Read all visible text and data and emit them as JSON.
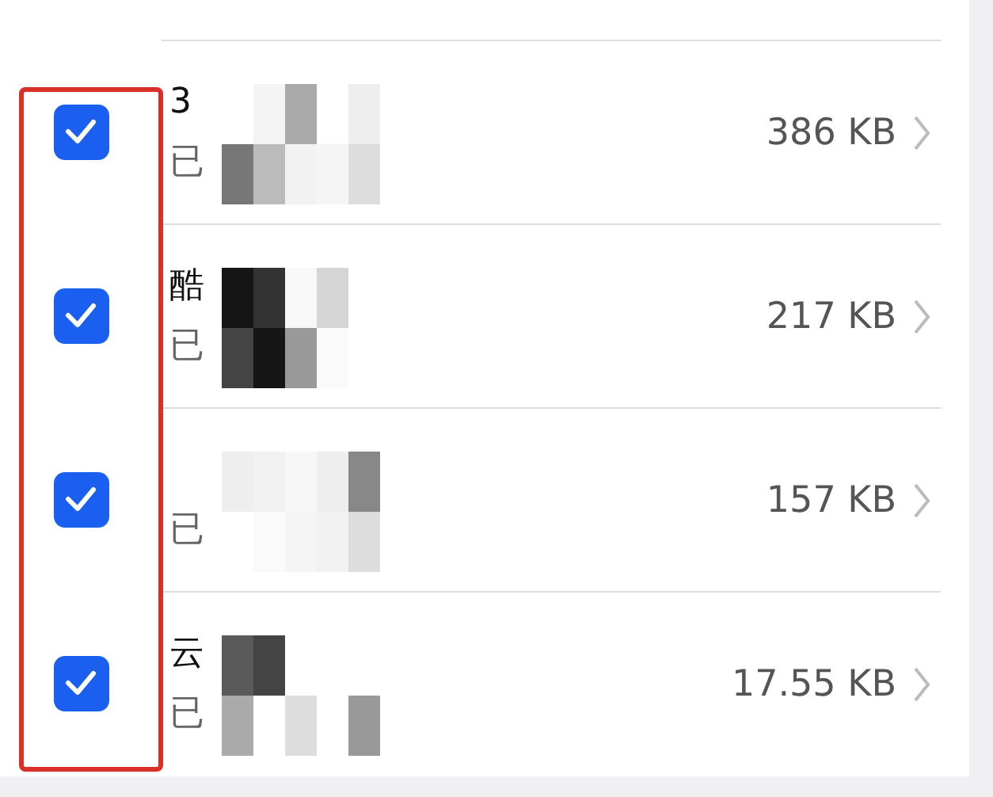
{
  "files": [
    {
      "title": "3",
      "subtitle": "已",
      "size": "386 KB",
      "checked": true
    },
    {
      "title": "酷",
      "subtitle": "已",
      "size": "217 KB",
      "checked": true
    },
    {
      "subtitle": "已",
      "size": "157 KB",
      "checked": true
    },
    {
      "title": "云",
      "subtitle": "已",
      "size": "17.55 KB",
      "checked": true
    }
  ]
}
